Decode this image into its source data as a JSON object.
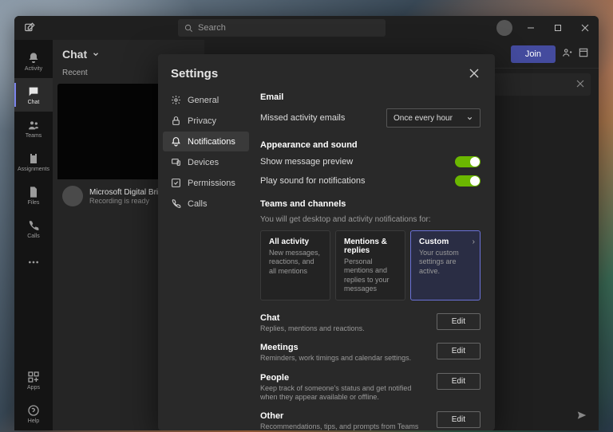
{
  "titlebar": {
    "search_placeholder": "Search"
  },
  "rail": {
    "items": [
      {
        "label": "Activity"
      },
      {
        "label": "Chat"
      },
      {
        "label": "Teams"
      },
      {
        "label": "Assignments"
      },
      {
        "label": "Files"
      },
      {
        "label": "Calls"
      }
    ],
    "apps_label": "Apps",
    "help_label": "Help"
  },
  "chat": {
    "header": "Chat",
    "filter": "Recent",
    "item": {
      "title": "Microsoft Digital Briefi",
      "subtitle": "Recording is ready"
    }
  },
  "header": {
    "join": "Join"
  },
  "settings": {
    "title": "Settings",
    "nav": [
      {
        "label": "General"
      },
      {
        "label": "Privacy"
      },
      {
        "label": "Notifications"
      },
      {
        "label": "Devices"
      },
      {
        "label": "Permissions"
      },
      {
        "label": "Calls"
      }
    ],
    "email": {
      "heading": "Email",
      "row_label": "Missed activity emails",
      "dropdown": "Once every hour"
    },
    "appearance": {
      "heading": "Appearance and sound",
      "preview": "Show message preview",
      "sound": "Play sound for notifications"
    },
    "teams": {
      "heading": "Teams and channels",
      "hint": "You will get desktop and activity notifications for:",
      "cards": [
        {
          "title": "All activity",
          "desc": "New messages, reactions, and all mentions"
        },
        {
          "title": "Mentions & replies",
          "desc": "Personal mentions and replies to your messages"
        },
        {
          "title": "Custom",
          "desc": "Your custom settings are active."
        }
      ]
    },
    "edit_label": "Edit",
    "sections": [
      {
        "title": "Chat",
        "desc": "Replies, mentions and reactions."
      },
      {
        "title": "Meetings",
        "desc": "Reminders, work timings and calendar settings."
      },
      {
        "title": "People",
        "desc": "Keep track of someone's status and get notified when they appear available or offline."
      },
      {
        "title": "Other",
        "desc": "Recommendations, tips, and prompts from Teams"
      }
    ]
  }
}
